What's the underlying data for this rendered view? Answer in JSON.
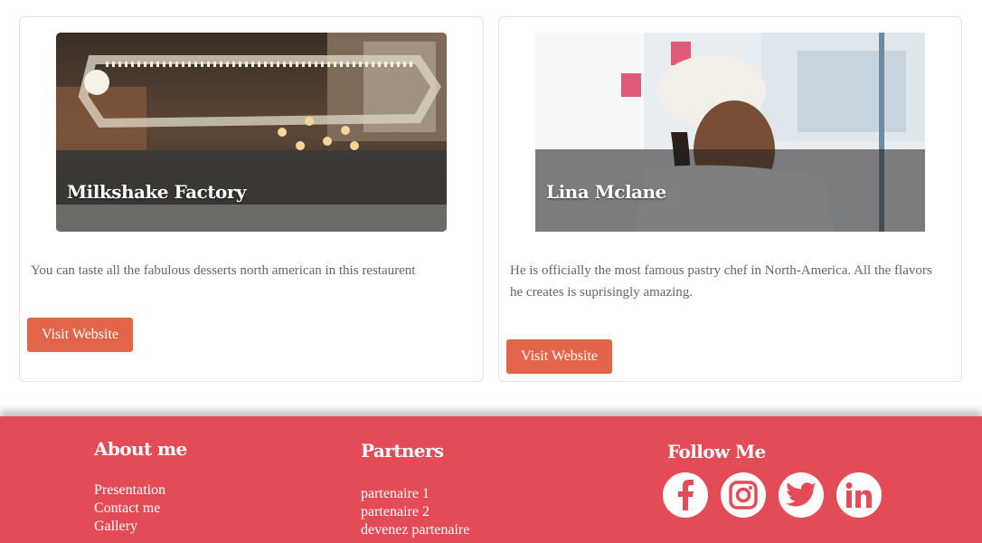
{
  "cards": [
    {
      "title": "Milkshake Factory",
      "description": "You can taste all the fabulous desserts north american in this restaurent",
      "button_label": "Visit Website"
    },
    {
      "title": "Lina Mclane",
      "description": "He is officially the most famous pastry chef in North-America. All the flavors he creates is suprisingly amazing.",
      "button_label": "Visit Website"
    }
  ],
  "footer": {
    "about": {
      "title": "About me",
      "links": [
        "Presentation",
        "Contact me",
        "Gallery"
      ]
    },
    "partners": {
      "title": "Partners",
      "links": [
        "partenaire 1",
        "partenaire 2",
        "devenez partenaire"
      ]
    },
    "follow": {
      "title": "Follow Me",
      "icons": [
        "facebook-icon",
        "instagram-icon",
        "twitter-icon",
        "linkedin-icon"
      ]
    }
  },
  "colors": {
    "accent_button": "#e2654a",
    "footer_bg": "#e34b57"
  }
}
